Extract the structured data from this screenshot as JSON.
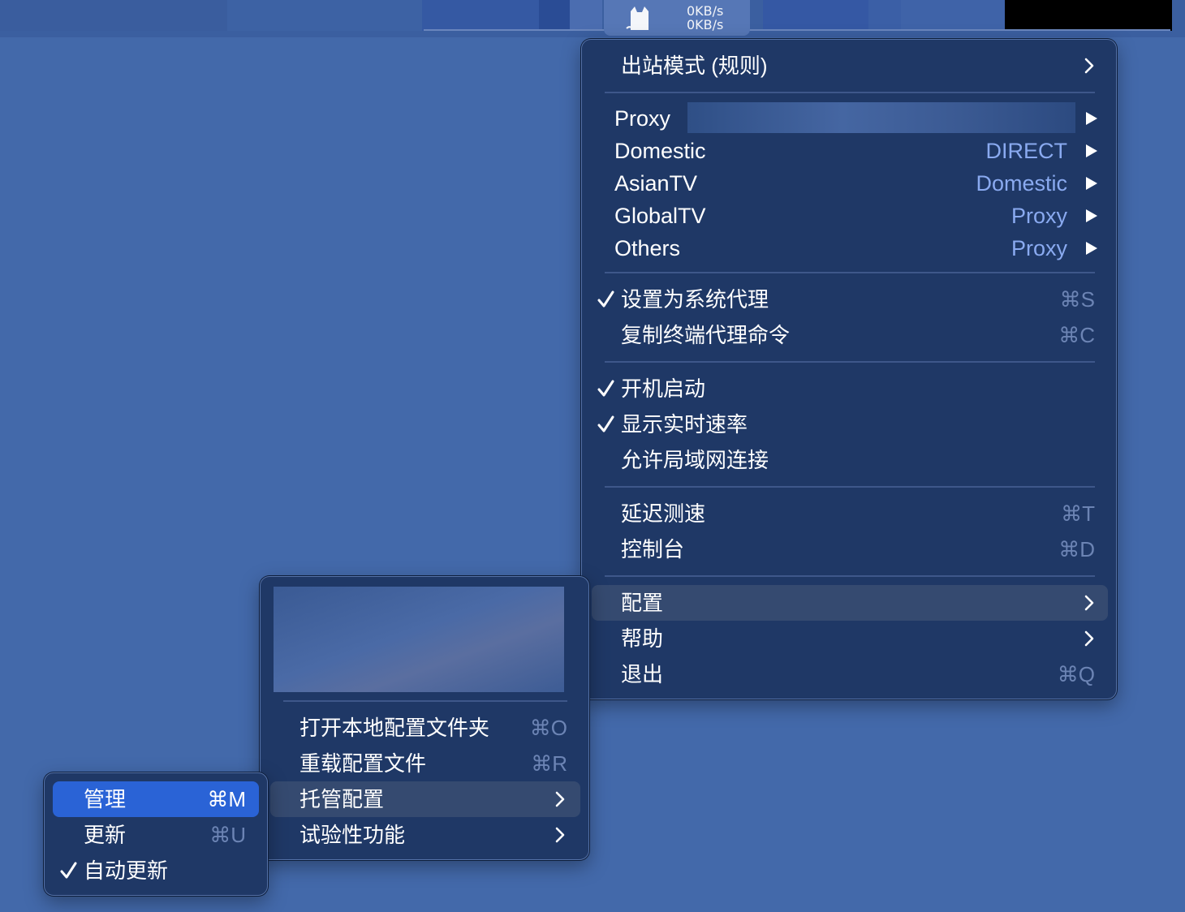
{
  "statusbar": {
    "upload": "0KB/s",
    "download": "0KB/s"
  },
  "main_menu": {
    "outbound_mode": "出站模式 (规则)",
    "proxy_groups": [
      {
        "name": "Proxy",
        "value": ""
      },
      {
        "name": "Domestic",
        "value": "DIRECT"
      },
      {
        "name": "AsianTV",
        "value": "Domestic"
      },
      {
        "name": "GlobalTV",
        "value": "Proxy"
      },
      {
        "name": "Others",
        "value": "Proxy"
      }
    ],
    "set_system_proxy": {
      "label": "设置为系统代理",
      "shortcut": "⌘S",
      "checked": true
    },
    "copy_terminal_cmd": {
      "label": "复制终端代理命令",
      "shortcut": "⌘C"
    },
    "launch_at_login": {
      "label": "开机启动",
      "checked": true
    },
    "show_speed": {
      "label": "显示实时速率",
      "checked": true
    },
    "allow_lan": {
      "label": "允许局域网连接",
      "checked": false
    },
    "latency_test": {
      "label": "延迟测速",
      "shortcut": "⌘T"
    },
    "dashboard": {
      "label": "控制台",
      "shortcut": "⌘D"
    },
    "config": {
      "label": "配置"
    },
    "help": {
      "label": "帮助"
    },
    "quit": {
      "label": "退出",
      "shortcut": "⌘Q"
    }
  },
  "config_menu": {
    "open_folder": {
      "label": "打开本地配置文件夹",
      "shortcut": "⌘O"
    },
    "reload": {
      "label": "重载配置文件",
      "shortcut": "⌘R"
    },
    "managed": {
      "label": "托管配置"
    },
    "experimental": {
      "label": "试验性功能"
    }
  },
  "managed_menu": {
    "manage": {
      "label": "管理",
      "shortcut": "⌘M"
    },
    "update": {
      "label": "更新",
      "shortcut": "⌘U"
    },
    "auto_update": {
      "label": "自动更新",
      "checked": true
    }
  },
  "colors": {
    "desktop": "#4369aa",
    "menu_bg": "#1f3866",
    "value_text": "#8aaaf0",
    "highlight_blue": "#2a63d6",
    "highlight_dark": "#354a70"
  }
}
